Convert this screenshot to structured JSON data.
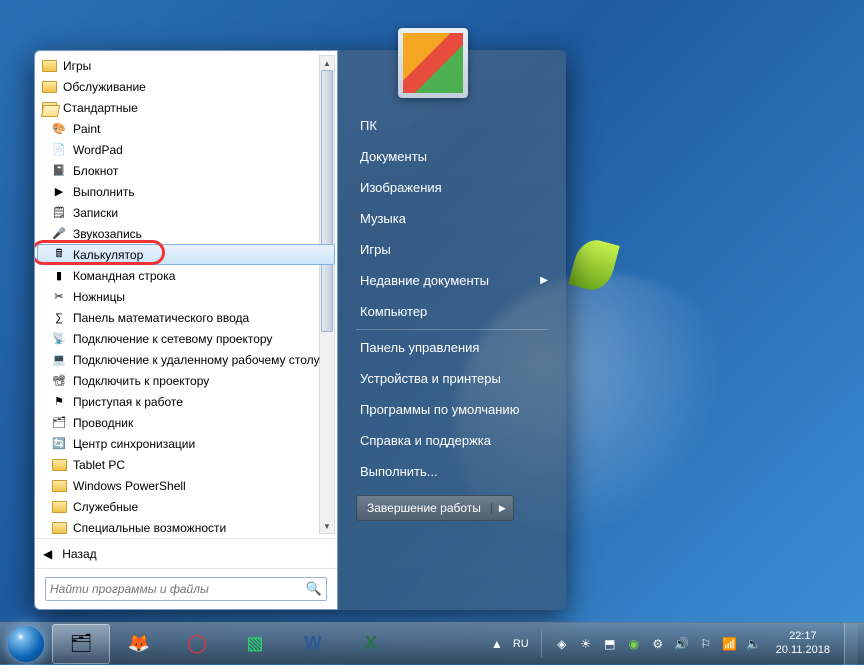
{
  "start_menu": {
    "programs": [
      {
        "label": "Игры",
        "icon": "folder",
        "root": true
      },
      {
        "label": "Обслуживание",
        "icon": "folder",
        "root": true
      },
      {
        "label": "Стандартные",
        "icon": "folder-open",
        "root": true
      },
      {
        "label": "Paint",
        "icon": "paint"
      },
      {
        "label": "WordPad",
        "icon": "wordpad"
      },
      {
        "label": "Блокнот",
        "icon": "notepad"
      },
      {
        "label": "Выполнить",
        "icon": "run"
      },
      {
        "label": "Записки",
        "icon": "sticky"
      },
      {
        "label": "Звукозапись",
        "icon": "sound"
      },
      {
        "label": "Калькулятор",
        "icon": "calc",
        "selected": true,
        "ring": true
      },
      {
        "label": "Командная строка",
        "icon": "cmd"
      },
      {
        "label": "Ножницы",
        "icon": "snip"
      },
      {
        "label": "Панель математического ввода",
        "icon": "math"
      },
      {
        "label": "Подключение к сетевому проектору",
        "icon": "netproj"
      },
      {
        "label": "Подключение к удаленному рабочему столу",
        "icon": "rdp"
      },
      {
        "label": "Подключить к проектору",
        "icon": "proj"
      },
      {
        "label": "Приступая к работе",
        "icon": "start"
      },
      {
        "label": "Проводник",
        "icon": "explorer"
      },
      {
        "label": "Центр синхронизации",
        "icon": "sync"
      },
      {
        "label": "Tablet PC",
        "icon": "folder"
      },
      {
        "label": "Windows PowerShell",
        "icon": "folder"
      },
      {
        "label": "Служебные",
        "icon": "folder"
      },
      {
        "label": "Специальные возможности",
        "icon": "folder"
      }
    ],
    "back_label": "Назад",
    "search_placeholder": "Найти программы и файлы"
  },
  "right_pane": {
    "items": [
      {
        "label": "ПК"
      },
      {
        "label": "Документы"
      },
      {
        "label": "Изображения"
      },
      {
        "label": "Музыка"
      },
      {
        "label": "Игры"
      },
      {
        "label": "Недавние документы",
        "arrow": true
      },
      {
        "label": "Компьютер",
        "sep_after": true
      },
      {
        "label": "Панель управления"
      },
      {
        "label": "Устройства и принтеры"
      },
      {
        "label": "Программы по умолчанию"
      },
      {
        "label": "Справка и поддержка"
      },
      {
        "label": "Выполнить..."
      }
    ],
    "shutdown_label": "Завершение работы"
  },
  "taskbar": {
    "lang": "RU",
    "time": "22:17",
    "date": "20.11.2018"
  },
  "icon_glyphs": {
    "paint": "🎨",
    "wordpad": "📄",
    "notepad": "📓",
    "run": "▶",
    "sticky": "🗒",
    "sound": "🎤",
    "calc": "🖩",
    "cmd": "▮",
    "snip": "✂",
    "math": "∑",
    "netproj": "📡",
    "rdp": "💻",
    "proj": "📽",
    "start": "⚑",
    "explorer": "🗂",
    "sync": "🔄"
  }
}
